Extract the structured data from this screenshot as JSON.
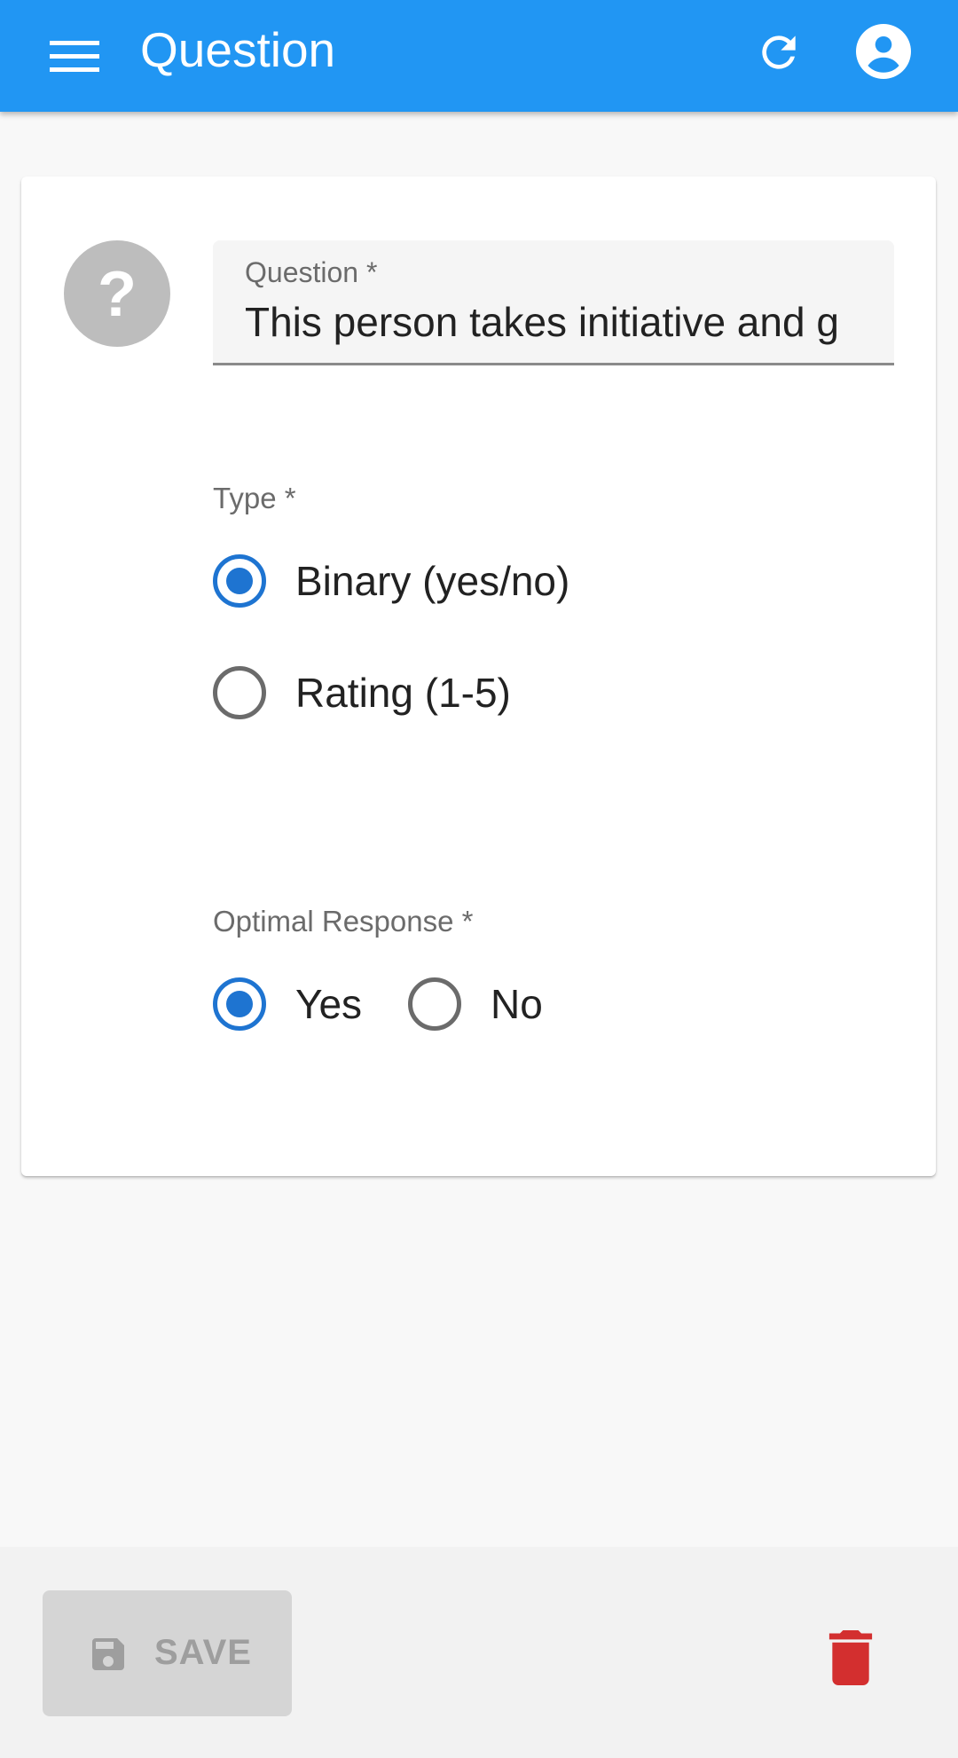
{
  "appbar": {
    "title": "Question",
    "menu_icon": "hamburger-menu-icon",
    "refresh_icon": "refresh-icon",
    "account_icon": "account-circle-icon",
    "color": "#2196f3"
  },
  "form": {
    "avatar_icon": "question-mark-icon",
    "question": {
      "label": "Question *",
      "value": "This person takes initiative and g"
    },
    "type": {
      "label": "Type *",
      "options": [
        {
          "label": "Binary (yes/no)",
          "selected": true
        },
        {
          "label": "Rating (1-5)",
          "selected": false
        }
      ]
    },
    "optimal_response": {
      "label": "Optimal Response *",
      "options": [
        {
          "label": "Yes",
          "selected": true
        },
        {
          "label": "No",
          "selected": false
        }
      ]
    }
  },
  "actions": {
    "save_label": "SAVE",
    "save_icon": "floppy-disk-icon",
    "delete_icon": "trash-icon",
    "delete_color": "#d32f2f"
  },
  "colors": {
    "accent": "#1e74d1",
    "disabled": "#9e9e9e"
  }
}
